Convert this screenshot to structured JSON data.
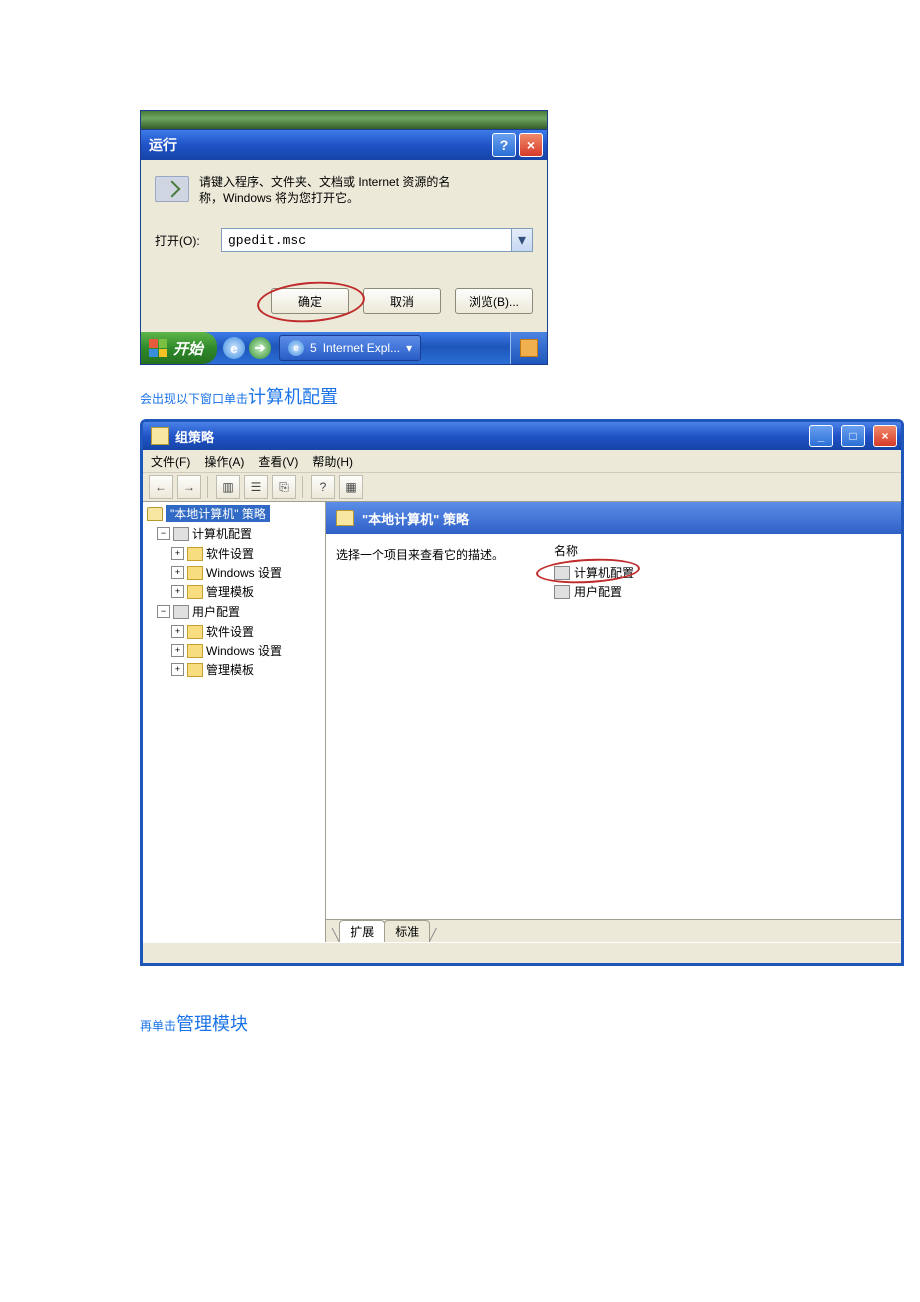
{
  "run_dialog": {
    "title": "运行",
    "desc_line1": "请键入程序、文件夹、文档或 Internet 资源的名",
    "desc_line2": "称，Windows 将为您打开它。",
    "open_label": "打开(O):",
    "input_value": "gpedit.msc",
    "ok": "确定",
    "cancel": "取消",
    "browse": "浏览(B)..."
  },
  "taskbar": {
    "start": "开始",
    "task1_num": "5",
    "task1": "Internet Expl..."
  },
  "caption1_small": "会出现以下窗口单击",
  "caption1_big": "计算机配置",
  "mmc": {
    "title": "组策略",
    "menu": {
      "file": "文件(F)",
      "action": "操作(A)",
      "view": "查看(V)",
      "help": "帮助(H)"
    },
    "tree": {
      "root": "\"本地计算机\" 策略",
      "comp": "计算机配置",
      "comp_soft": "软件设置",
      "comp_win": "Windows 设置",
      "comp_admin": "管理模板",
      "user": "用户配置",
      "user_soft": "软件设置",
      "user_win": "Windows 设置",
      "user_admin": "管理模板"
    },
    "content_title": "\"本地计算机\" 策略",
    "desc_hint": "选择一个项目来查看它的描述。",
    "col_name": "名称",
    "item_comp": "计算机配置",
    "item_user": "用户配置",
    "tab_ext": "扩展",
    "tab_std": "标准"
  },
  "caption2_small": "再单击",
  "caption2_big": "管理模块"
}
